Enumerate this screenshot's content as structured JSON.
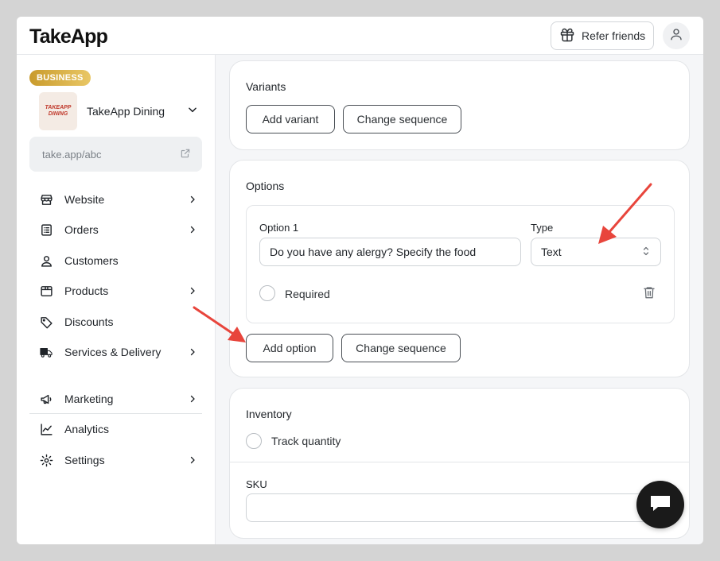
{
  "header": {
    "logo": "TakeApp",
    "refer_label": "Refer friends"
  },
  "sidebar": {
    "badge": "BUSINESS",
    "store_logo_lines": [
      "TAKEAPP",
      "DINING"
    ],
    "store_name": "TakeApp Dining",
    "store_url": "take.app/abc",
    "items": [
      {
        "label": "Website",
        "icon": "store-icon",
        "chevron": true
      },
      {
        "label": "Orders",
        "icon": "receipt-icon",
        "chevron": true
      },
      {
        "label": "Customers",
        "icon": "user-icon",
        "chevron": false
      },
      {
        "label": "Products",
        "icon": "box-icon",
        "chevron": true
      },
      {
        "label": "Discounts",
        "icon": "tag-icon",
        "chevron": false
      },
      {
        "label": "Services & Delivery",
        "icon": "truck-icon",
        "chevron": true
      },
      {
        "label": "Marketing",
        "icon": "megaphone-icon",
        "chevron": true
      },
      {
        "label": "Analytics",
        "icon": "chart-line-icon",
        "chevron": false
      },
      {
        "label": "Settings",
        "icon": "gear-icon",
        "chevron": true
      }
    ]
  },
  "variants": {
    "title": "Variants",
    "add_label": "Add variant",
    "sequence_label": "Change sequence"
  },
  "options": {
    "title": "Options",
    "option_label": "Option 1",
    "option_value": "Do you have any alergy? Specify the food",
    "type_label": "Type",
    "type_value": "Text",
    "required_label": "Required",
    "add_label": "Add option",
    "sequence_label": "Change sequence"
  },
  "inventory": {
    "title": "Inventory",
    "track_label": "Track quantity",
    "sku_label": "SKU",
    "sku_value": ""
  },
  "colors": {
    "accent_arrow": "#e8453c",
    "badge_gold": "#d4a93e",
    "chat_bg": "#1a1a1a"
  }
}
